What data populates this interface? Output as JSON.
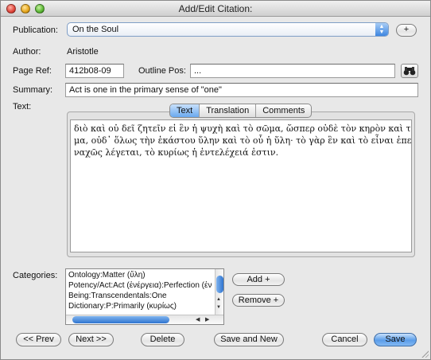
{
  "window": {
    "title": "Add/Edit Citation:"
  },
  "publication": {
    "label": "Publication:",
    "value": "On the Soul",
    "add_label": "+"
  },
  "author": {
    "label": "Author:",
    "value": "Aristotle"
  },
  "page_ref": {
    "label": "Page Ref:",
    "value": "412b08-09"
  },
  "outline_pos": {
    "label": "Outline Pos:",
    "value": "..."
  },
  "summary": {
    "label": "Summary:",
    "value": "Act is one in the primary sense of \"one\""
  },
  "text_section": {
    "label": "Text:",
    "tabs": [
      {
        "label": "Text",
        "active": true
      },
      {
        "label": "Translation",
        "active": false
      },
      {
        "label": "Comments",
        "active": false
      }
    ],
    "lines": [
      "διὸ καὶ οὐ δεῖ ζητεῖν εἰ ἓν ἡ ψυχὴ καὶ τὸ σῶμα, ὥσπερ οὐδὲ τὸν κηρὸν καὶ τὸ σχῆ",
      "μα, οὐδ᾽ ὅλως τὴν ἑκάστου ὕλην καὶ τὸ οὗ ἡ ὕλη· τὸ γὰρ ἓν καὶ τὸ εἶναι ἐπεὶ πλεο",
      "ναχῶς λέγεται, τὸ κυρίως ἡ ἐντελέχειά ἐστιν."
    ]
  },
  "categories": {
    "label": "Categories:",
    "items": [
      "Ontology:Matter (ὕλη)",
      "Potency/Act:Act (ἐνέργεια):Perfection (ἐν",
      "Being:Transcendentals:One",
      "Dictionary:P:Primarily (κυρίως)"
    ],
    "add_label": "Add +",
    "remove_label": "Remove +"
  },
  "footer": {
    "prev_label": "<< Prev",
    "next_label": "Next >>",
    "delete_label": "Delete",
    "save_new_label": "Save and New",
    "cancel_label": "Cancel",
    "save_label": "Save"
  },
  "icons": {
    "popup_arrows": "up-down-chevron-icon",
    "link": "binoculars-icon"
  },
  "colors": {
    "accent": "#5a9de9"
  }
}
